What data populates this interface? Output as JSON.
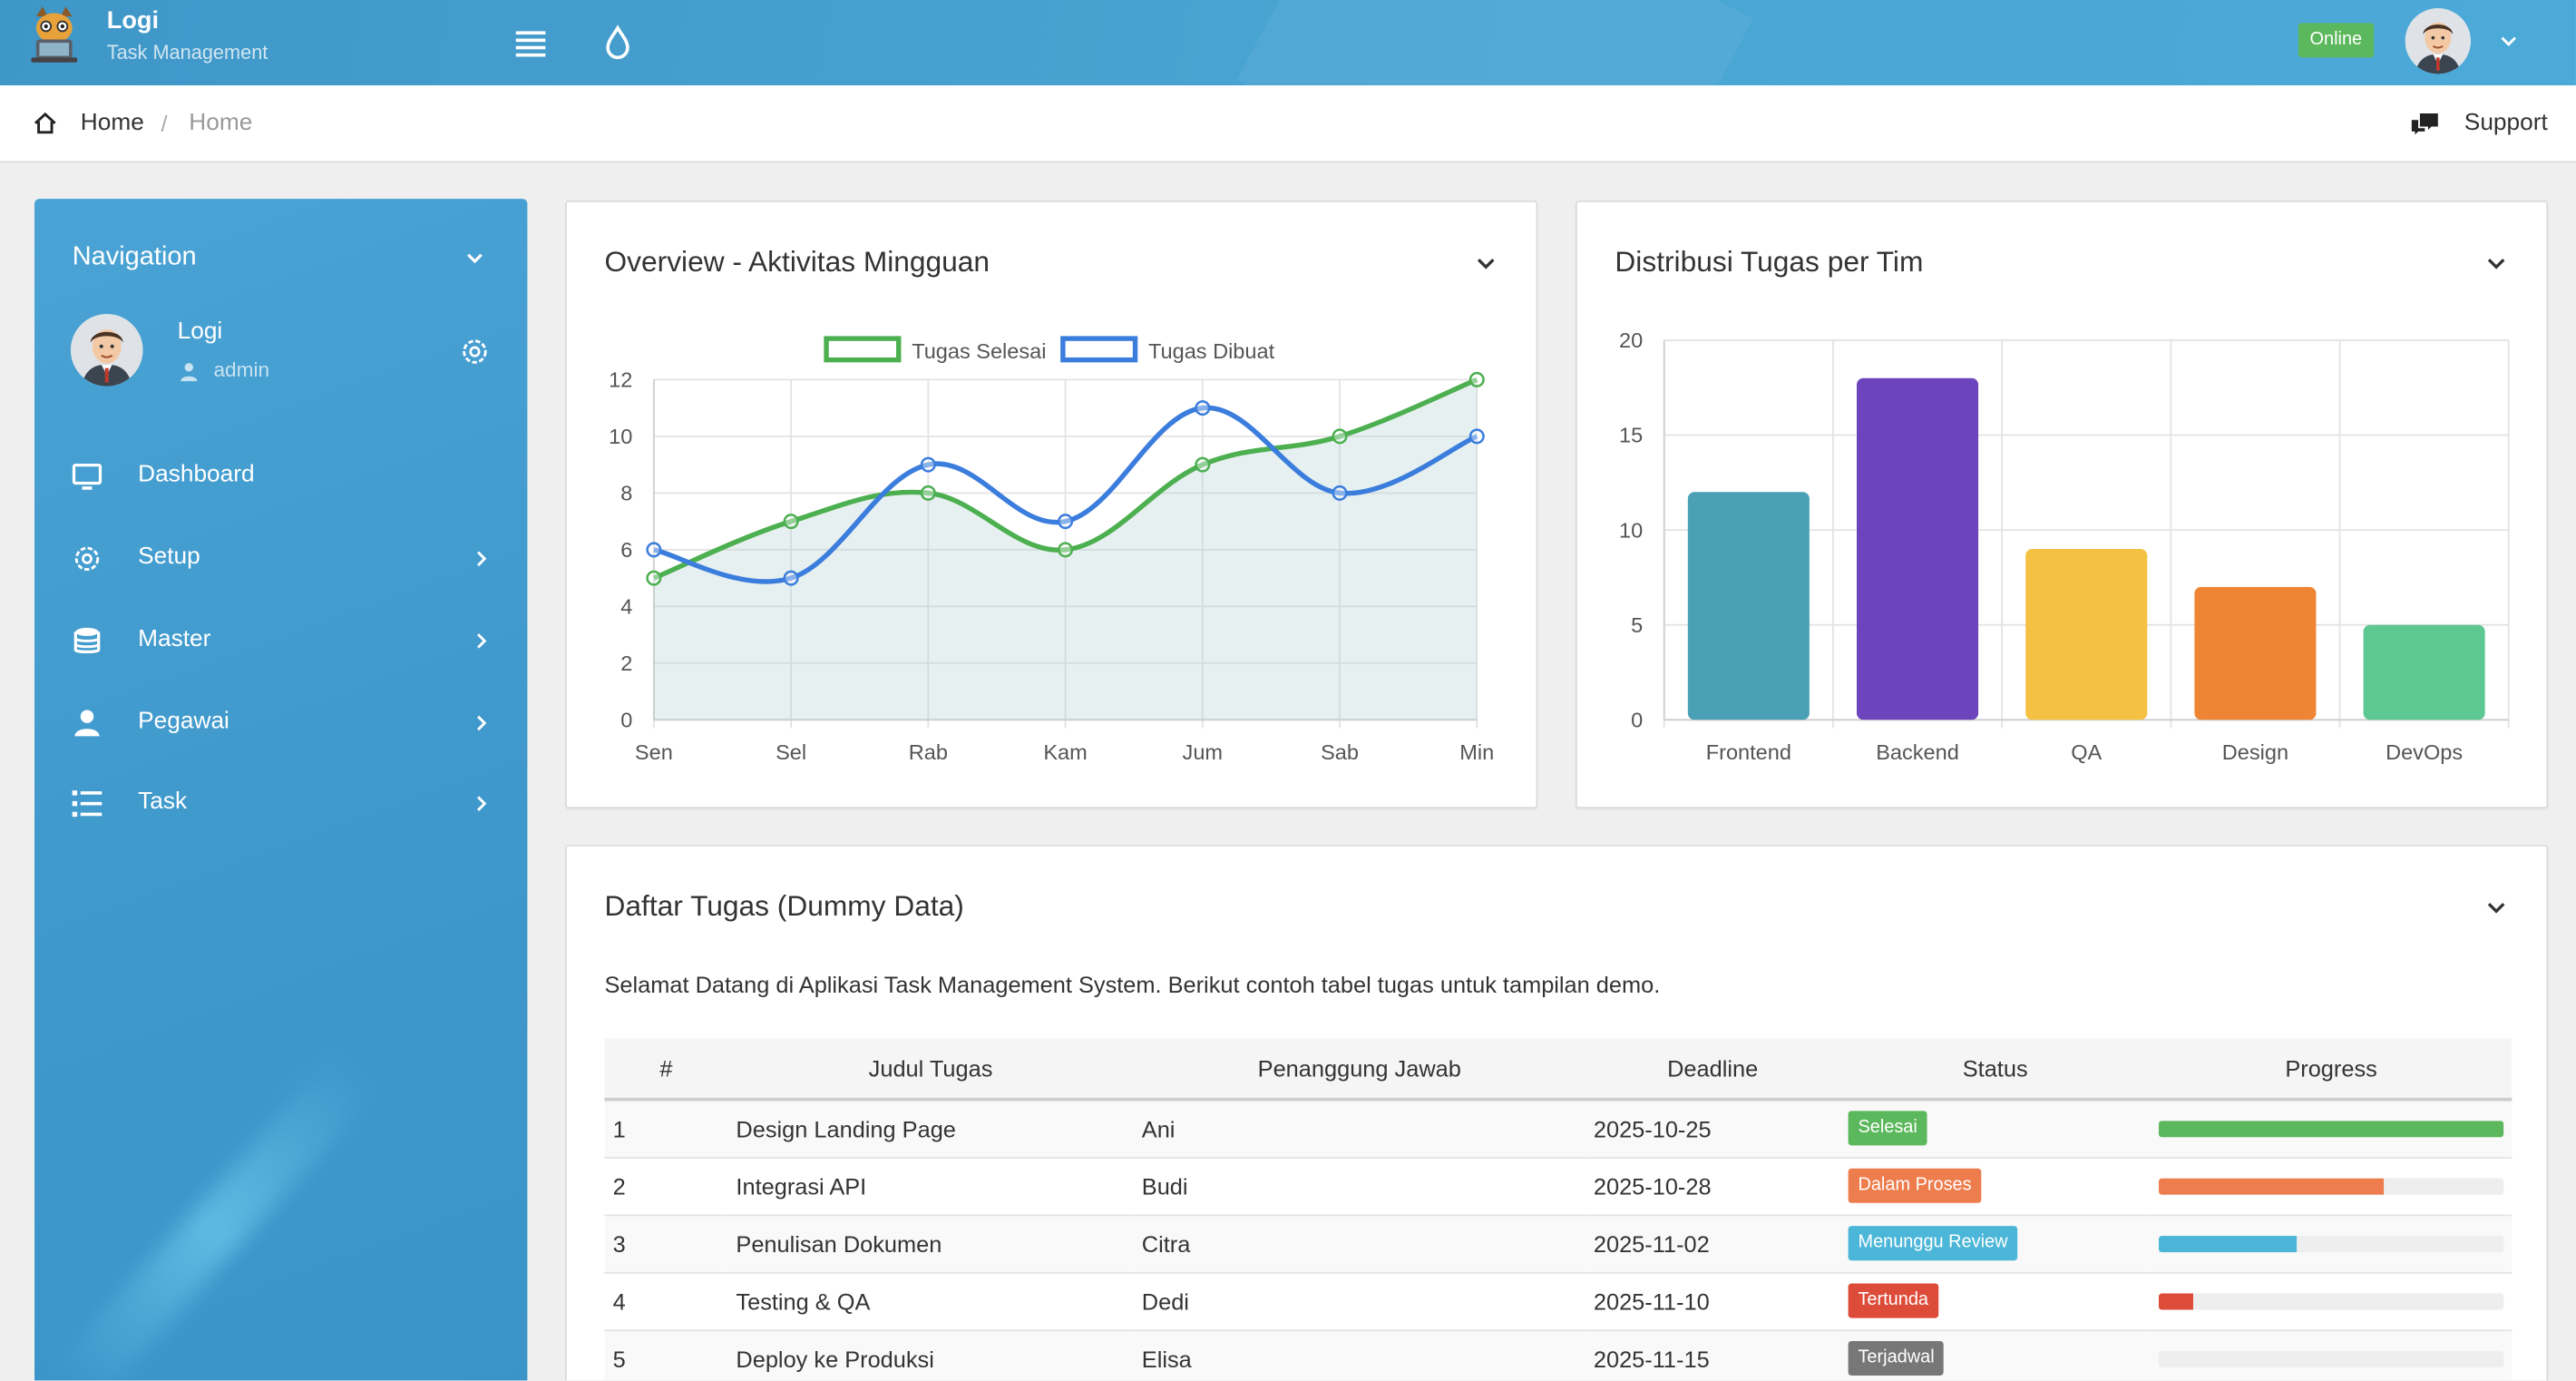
{
  "topbar": {
    "app_name": "Logi",
    "app_subtitle": "Task Management",
    "status_badge": "Online",
    "icons": [
      "hamburger-menu-icon",
      "droplet-icon",
      "chevron-down-icon"
    ]
  },
  "breadcrumb": {
    "home": "Home",
    "separator": "/",
    "current": "Home",
    "support_label": "Support"
  },
  "sidebar": {
    "title": "Navigation",
    "user": {
      "name": "Logi",
      "role": "admin"
    },
    "items": [
      {
        "label": "Dashboard",
        "icon": "monitor-icon",
        "has_children": false
      },
      {
        "label": "Setup",
        "icon": "gear-icon",
        "has_children": true
      },
      {
        "label": "Master",
        "icon": "database-icon",
        "has_children": true
      },
      {
        "label": "Pegawai",
        "icon": "user-icon",
        "has_children": true
      },
      {
        "label": "Task",
        "icon": "list-icon",
        "has_children": true
      }
    ]
  },
  "weekly_panel": {
    "title": "Overview - Aktivitas Mingguan"
  },
  "team_panel": {
    "title": "Distribusi Tugas per Tim"
  },
  "tasks_panel": {
    "title": "Daftar Tugas (Dummy Data)",
    "intro": "Selamat Datang di Aplikasi Task Management System. Berikut contoh tabel tugas untuk tampilan demo.",
    "columns": [
      "#",
      "Judul Tugas",
      "Penanggung Jawab",
      "Deadline",
      "Status",
      "Progress"
    ],
    "rows": [
      {
        "no": "1",
        "title": "Design Landing Page",
        "owner": "Ani",
        "deadline": "2025-10-25",
        "status": "Selesai",
        "status_color": "#5cb85c",
        "progress": 1.0,
        "progress_color": "#5cb85c"
      },
      {
        "no": "2",
        "title": "Integrasi API",
        "owner": "Budi",
        "deadline": "2025-10-28",
        "status": "Dalam Proses",
        "status_color": "#ee7d4e",
        "progress": 0.65,
        "progress_color": "#ee7d4e"
      },
      {
        "no": "3",
        "title": "Penulisan Dokumen",
        "owner": "Citra",
        "deadline": "2025-11-02",
        "status": "Menunggu Review",
        "status_color": "#4cb6d8",
        "progress": 0.4,
        "progress_color": "#4cb6d8"
      },
      {
        "no": "4",
        "title": "Testing & QA",
        "owner": "Dedi",
        "deadline": "2025-11-10",
        "status": "Tertunda",
        "status_color": "#dd4b39",
        "progress": 0.1,
        "progress_color": "#dd4b39"
      },
      {
        "no": "5",
        "title": "Deploy ke Produksi",
        "owner": "Elisa",
        "deadline": "2025-11-15",
        "status": "Terjadwal",
        "status_color": "#777777",
        "progress": 0,
        "progress_color": "#777777"
      }
    ]
  },
  "chart_data": [
    {
      "type": "line",
      "title": "Overview - Aktivitas Mingguan",
      "categories": [
        "Sen",
        "Sel",
        "Rab",
        "Kam",
        "Jum",
        "Sab",
        "Min"
      ],
      "series": [
        {
          "name": "Tugas Selesai",
          "values": [
            5,
            7,
            8,
            6,
            9,
            10,
            12
          ],
          "color": "#4caf50",
          "filled": true
        },
        {
          "name": "Tugas Dibuat",
          "values": [
            6,
            5,
            9,
            7,
            11,
            8,
            10
          ],
          "color": "#3b7ddd",
          "filled": false
        }
      ],
      "ylim": [
        0,
        12
      ],
      "yticks": [
        0,
        2,
        4,
        6,
        8,
        10,
        12
      ],
      "grid": true,
      "legend": "top-center"
    },
    {
      "type": "bar",
      "title": "Distribusi Tugas per Tim",
      "categories": [
        "Frontend",
        "Backend",
        "QA",
        "Design",
        "DevOps"
      ],
      "values": [
        12,
        18,
        9,
        7,
        5
      ],
      "colors": [
        "#4aa0b5",
        "#6c44bb",
        "#f4c142",
        "#ee8534",
        "#5ec893"
      ],
      "ylim": [
        0,
        20
      ],
      "yticks": [
        0,
        5,
        10,
        15,
        20
      ],
      "grid": true
    }
  ]
}
